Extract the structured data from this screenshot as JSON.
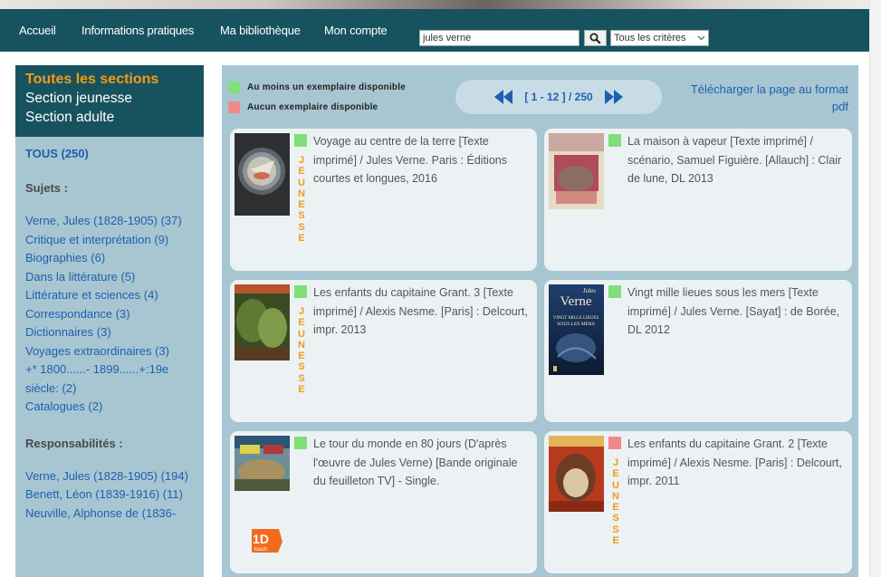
{
  "nav": {
    "items": [
      "Accueil",
      "Informations pratiques",
      "Ma bibliothèque",
      "Mon compte"
    ],
    "search_value": "jules verne",
    "criteria_selected": "Tous les critères"
  },
  "sidebar": {
    "sections_title": "Toutes les sections",
    "section_jeunesse": "Section jeunesse",
    "section_adulte": "Section adulte",
    "tous": "TOUS (250)",
    "sujets_title": "Sujets :",
    "sujets": [
      "Verne, Jules (1828-1905) (37)",
      "Critique et interprétation (9)",
      "Biographies (6)",
      "Dans la littérature (5)",
      "Littérature et sciences (4)",
      "Correspondance (3)",
      "Dictionnaires (3)",
      "Voyages extraordinaires (3)",
      "+* 1800......- 1899......+:19e siècle: (2)",
      "Catalogues (2)"
    ],
    "responsabilites_title": "Responsabilités :",
    "responsabilites": [
      "Verne, Jules (1828-1905) (194)",
      "Benett, Léon (1839-1916) (11)",
      "Neuville, Alphonse de (1836-"
    ]
  },
  "legend": {
    "available": "Au moins un exemplaire disponible",
    "unavailable": "Aucun exemplaire disponible"
  },
  "pager": {
    "range": "[ 1 - 12 ] / 250"
  },
  "pdf_link": "Télécharger la page au format pdf",
  "jeunesse_label": "JEUNESSE",
  "badge_text": "1D touch",
  "colors": {
    "nav_bg": "#17535f",
    "panel_bg": "#a7c6d1",
    "card_bg": "#ecf2f4",
    "available": "#7fe07a",
    "unavailable": "#f08a8a",
    "accent_orange": "#f39a1b",
    "link_blue": "#1f5fb0"
  },
  "results": [
    {
      "title": "Voyage au centre de la terre [Texte imprimé] / Jules Verne. Paris : Éditions courtes et longues, 2016",
      "available": true,
      "jeunesse": true,
      "cover": "compass-cover"
    },
    {
      "title": "La maison à vapeur [Texte imprimé] / scénario, Samuel Figuière. [Allauch] : Clair de lune, DL 2013",
      "available": true,
      "jeunesse": false,
      "cover": "elephant-comic-cover"
    },
    {
      "title": "Les enfants du capitaine Grant. 3 [Texte imprimé] / Alexis Nesme. [Paris] : Delcourt, impr. 2013",
      "available": true,
      "jeunesse": true,
      "cover": "jungle-comic-cover"
    },
    {
      "title": "Vingt mille lieues sous les mers [Texte imprimé] / Jules Verne. [Sayat] : de Borée, DL 2012",
      "available": true,
      "jeunesse": false,
      "cover": "vingt-mille-lieues-cover",
      "cover_author": "Jules",
      "cover_author2": "Verne",
      "cover_title": "VINGT MILLE LIEUES SOUS LES MERS"
    },
    {
      "title": "Le tour du monde en 80 jours (D'après l'œuvre de Jules Verne) [Bande originale du feuilleton TV] - Single.",
      "available": true,
      "jeunesse": false,
      "cover": "tv-soundtrack-cover",
      "badge": true
    },
    {
      "title": "Les enfants du capitaine Grant. 2 [Texte imprimé] / Alexis Nesme. [Paris] : Delcourt, impr. 2011",
      "available": false,
      "jeunesse": true,
      "cover": "red-comic-cover"
    }
  ]
}
